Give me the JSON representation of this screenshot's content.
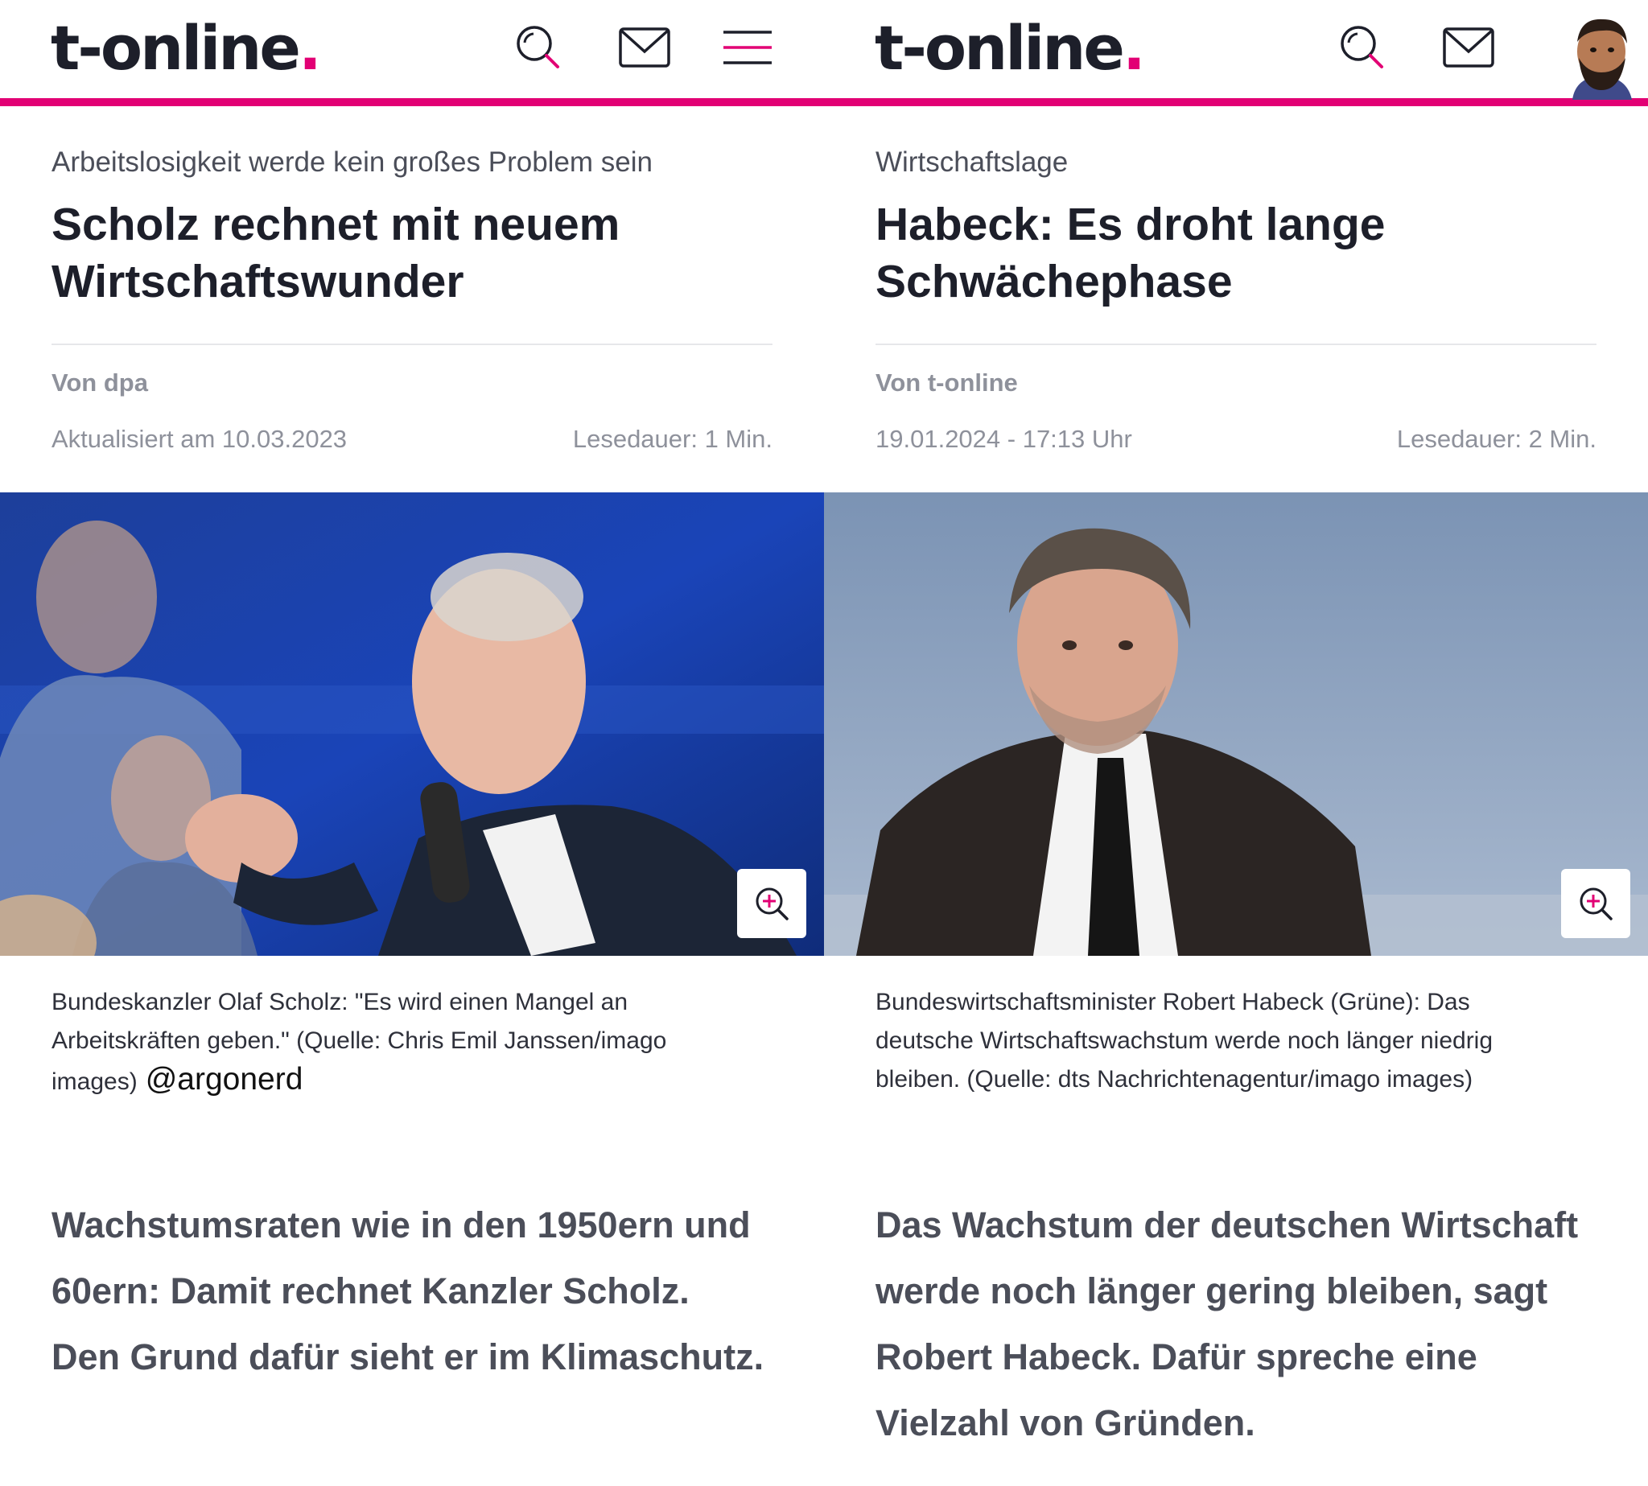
{
  "colors": {
    "brand": "#e20074",
    "text": "#1d1f2a",
    "muted": "#8e919b"
  },
  "left": {
    "header": {
      "logo_text": "t-online",
      "logo_dot": ".",
      "icons": [
        "search-icon",
        "mail-icon",
        "menu-icon"
      ]
    },
    "article": {
      "kicker": "Arbeitslosigkeit werde kein großes Problem sein",
      "headline_line1": "Scholz rechnet mit neuem",
      "headline_line2": "Wirtschaftswunder",
      "author": "Von dpa",
      "date": "Aktualisiert am 10.03.2023",
      "read_time": "Lesedauer: 1 Min.",
      "caption_line1": "Bundeskanzler Olaf Scholz: \"Es wird einen Mangel an",
      "caption_line2": "Arbeitskräften geben.\" (Quelle: Chris Emil Janssen/imago",
      "caption_line3": "images)",
      "watermark": "@argonerd",
      "lead_line1": "Wachstumsraten wie in den 1950ern und",
      "lead_line2": "60ern: Damit rechnet Kanzler Scholz.",
      "lead_line3": "Den Grund dafür sieht er im Klimaschutz."
    }
  },
  "right": {
    "header": {
      "logo_text": "t-online",
      "logo_dot": ".",
      "icons": [
        "search-icon",
        "mail-icon",
        "avatar"
      ]
    },
    "article": {
      "kicker": "Wirtschaftslage",
      "headline_line1": "Habeck: Es droht lange",
      "headline_line2": "Schwächephase",
      "author": "Von t-online",
      "date": "19.01.2024 - 17:13 Uhr",
      "read_time": "Lesedauer: 2 Min.",
      "caption_line1": "Bundeswirtschaftsminister Robert Habeck (Grüne): Das",
      "caption_line2": "deutsche Wirtschaftswachstum werde noch länger niedrig",
      "caption_line3": "bleiben. (Quelle: dts Nachrichtenagentur/imago images)",
      "lead_line1": "Das Wachstum der deutschen Wirtschaft",
      "lead_line2": "werde noch länger gering bleiben, sagt",
      "lead_line3": "Robert Habeck. Dafür spreche eine",
      "lead_line4": "Vielzahl von Gründen."
    }
  }
}
